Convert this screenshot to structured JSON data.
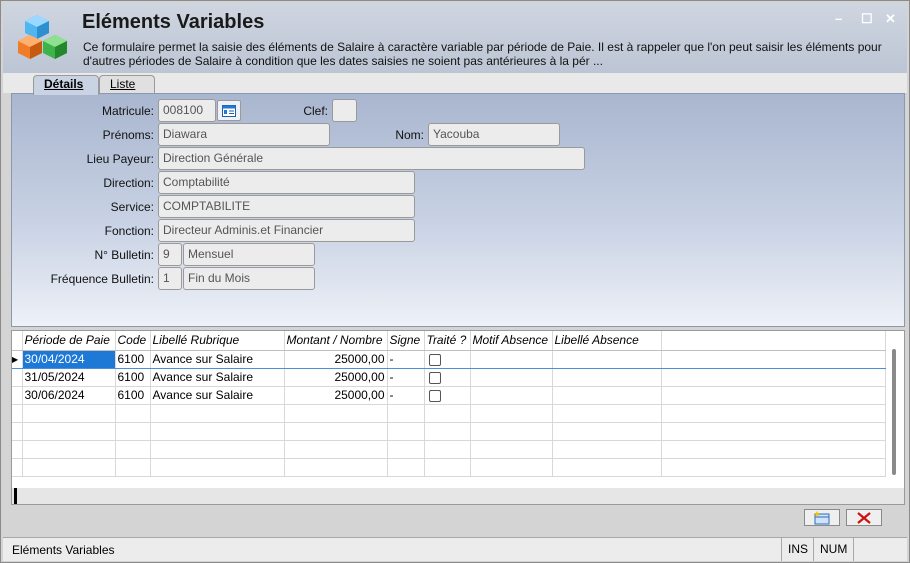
{
  "window": {
    "title": "Eléments Variables",
    "description": "Ce formulaire permet la saisie des éléments de Salaire à caractère variable par période de Paie. Il est à rappeler que l'on peut saisir les éléments pour d'autres périodes de Salaire à condition que les dates saisies ne soient pas antérieures à la pér ...",
    "controls": {
      "minimize": "–",
      "maximize": "☐",
      "close": "✕"
    }
  },
  "tabs": [
    {
      "label": "Détails",
      "active": true
    },
    {
      "label": "Liste",
      "active": false
    }
  ],
  "form": {
    "matricule": {
      "label": "Matricule:",
      "value": "008100"
    },
    "clef": {
      "label": "Clef:",
      "value": ""
    },
    "prenoms": {
      "label": "Prénoms:",
      "value": "Diawara"
    },
    "nom": {
      "label": "Nom:",
      "value": "Yacouba"
    },
    "lieu_payeur": {
      "label": "Lieu Payeur:",
      "value": "Direction Générale"
    },
    "direction": {
      "label": "Direction:",
      "value": "Comptabilité"
    },
    "service": {
      "label": "Service:",
      "value": "COMPTABILITE"
    },
    "fonction": {
      "label": "Fonction:",
      "value": "Directeur Adminis.et Financier"
    },
    "bulletin": {
      "label": "N° Bulletin:",
      "code": "9",
      "value": "Mensuel"
    },
    "frequence": {
      "label": "Fréquence Bulletin:",
      "code": "1",
      "value": "Fin du Mois"
    }
  },
  "grid": {
    "columns": [
      "Période de Paie",
      "Code",
      "Libellé Rubrique",
      "Montant / Nombre",
      "Signe",
      "Traité ?",
      "Motif Absence",
      "Libellé Absence"
    ],
    "rows": [
      {
        "periode": "30/04/2024",
        "code": "6100",
        "libelle": "Avance sur Salaire",
        "montant": "25000,00",
        "signe": "-",
        "traite": false,
        "motif": "",
        "libelle_absence": ""
      },
      {
        "periode": "31/05/2024",
        "code": "6100",
        "libelle": "Avance sur Salaire",
        "montant": "25000,00",
        "signe": "-",
        "traite": false,
        "motif": "",
        "libelle_absence": ""
      },
      {
        "periode": "30/06/2024",
        "code": "6100",
        "libelle": "Avance sur Salaire",
        "montant": "25000,00",
        "signe": "-",
        "traite": false,
        "motif": "",
        "libelle_absence": ""
      }
    ],
    "current_row_marker": "▶"
  },
  "icons": {
    "logo": "colored-cubes-icon",
    "picker": "id-card-icon",
    "new": "new-record-icon",
    "delete": "delete-x-icon"
  },
  "colors": {
    "accent": "#1e78d6",
    "delete": "#d01010",
    "header": "#c5cdd9"
  },
  "statusbar": {
    "text": "Eléments Variables",
    "ins": "INS",
    "num": "NUM"
  }
}
